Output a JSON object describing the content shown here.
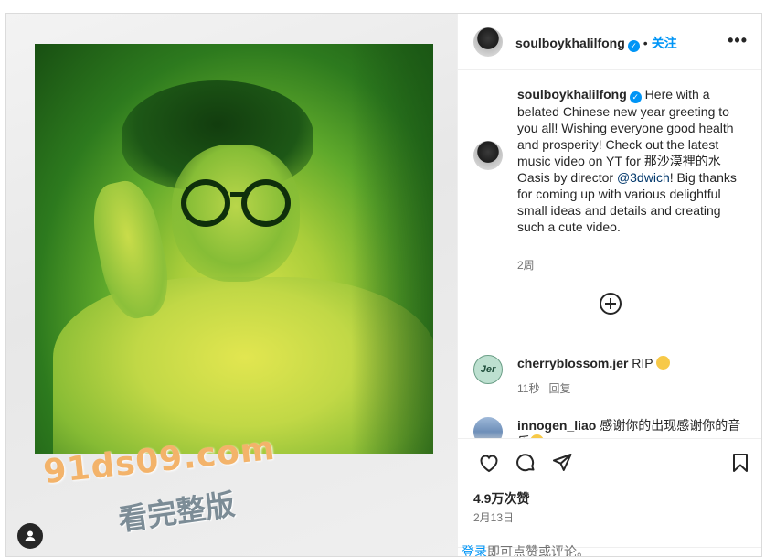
{
  "post": {
    "author": "soulboykhalilfong",
    "verified_mark": "✓",
    "separator": "•",
    "follow_label": "关注",
    "more_label": "•••",
    "caption_part1": " Here with a belated Chinese new year greeting to you all! Wishing everyone good health and prosperity! Check out the latest music video on YT for 那沙漠裡的水Oasis by director ",
    "caption_mention": "@3dwich",
    "caption_part2": "! Big thanks for coming up with various delightful small ideas and details and creating such a cute video.",
    "caption_time": "2周",
    "likes": "4.9万次赞",
    "date": "2月13日"
  },
  "comments": [
    {
      "user": "cherryblossom.jer",
      "text": " RIP",
      "time": "11秒",
      "reply_label": "回复",
      "avatar_text": "Jer"
    },
    {
      "user": "innogen_liao",
      "text": " 感谢你的出现感谢你的音乐",
      "heart": "❤"
    }
  ],
  "login_prompt": {
    "link": "登录",
    "text": "即可点赞或评论。"
  },
  "watermark": {
    "line1": "91ds09.com",
    "line2": "看完整版"
  },
  "icons": [
    "heart-icon",
    "comment-icon",
    "share-icon",
    "bookmark-icon",
    "add-comment-icon",
    "more-icon",
    "user-tag-icon",
    "verified-icon"
  ],
  "colors": {
    "accent": "#0095f6",
    "text": "#262626",
    "muted": "#737373",
    "heart": "#ed4956"
  }
}
